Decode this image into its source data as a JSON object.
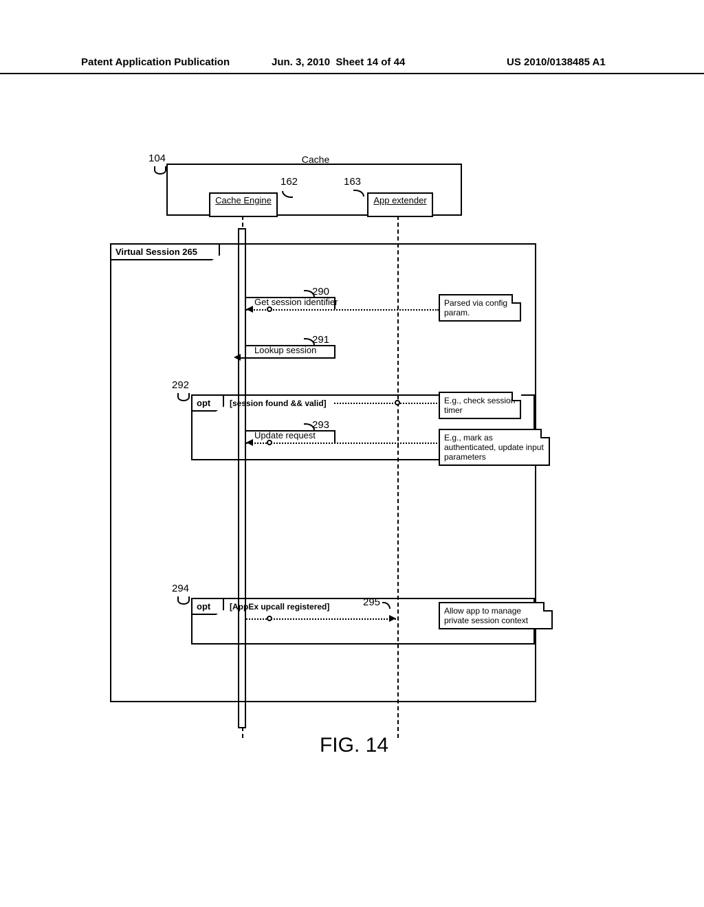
{
  "header": {
    "left": "Patent Application Publication",
    "date": "Jun. 3, 2010",
    "sheet": "Sheet 14 of 44",
    "pubnum": "US 2010/0138485 A1"
  },
  "cache_block": {
    "ref_main": "104",
    "title": "Cache",
    "engine": {
      "label": "Cache Engine",
      "ref": "162"
    },
    "extender": {
      "label": "App extender",
      "ref": "163"
    }
  },
  "virtual_session": {
    "label": "Virtual Session 265"
  },
  "messages": {
    "m290": {
      "ref": "290",
      "label": "Get session identifier"
    },
    "m291": {
      "ref": "291",
      "label": "Lookup session"
    },
    "m293": {
      "ref": "293",
      "label": "Update request"
    },
    "m295": {
      "ref": "295"
    }
  },
  "frames": {
    "opt292": {
      "ref": "292",
      "type": "opt",
      "guard": "[session found && valid]"
    },
    "opt294": {
      "ref": "294",
      "type": "opt",
      "guard": "[AppEx upcall registered]"
    }
  },
  "notes": {
    "n290": "Parsed via config param.",
    "n292": "E.g., check session timer",
    "n293": "E.g., mark as authenticated, update input parameters",
    "n295": "Allow app to manage private session context"
  },
  "figure_label": "FIG. 14"
}
